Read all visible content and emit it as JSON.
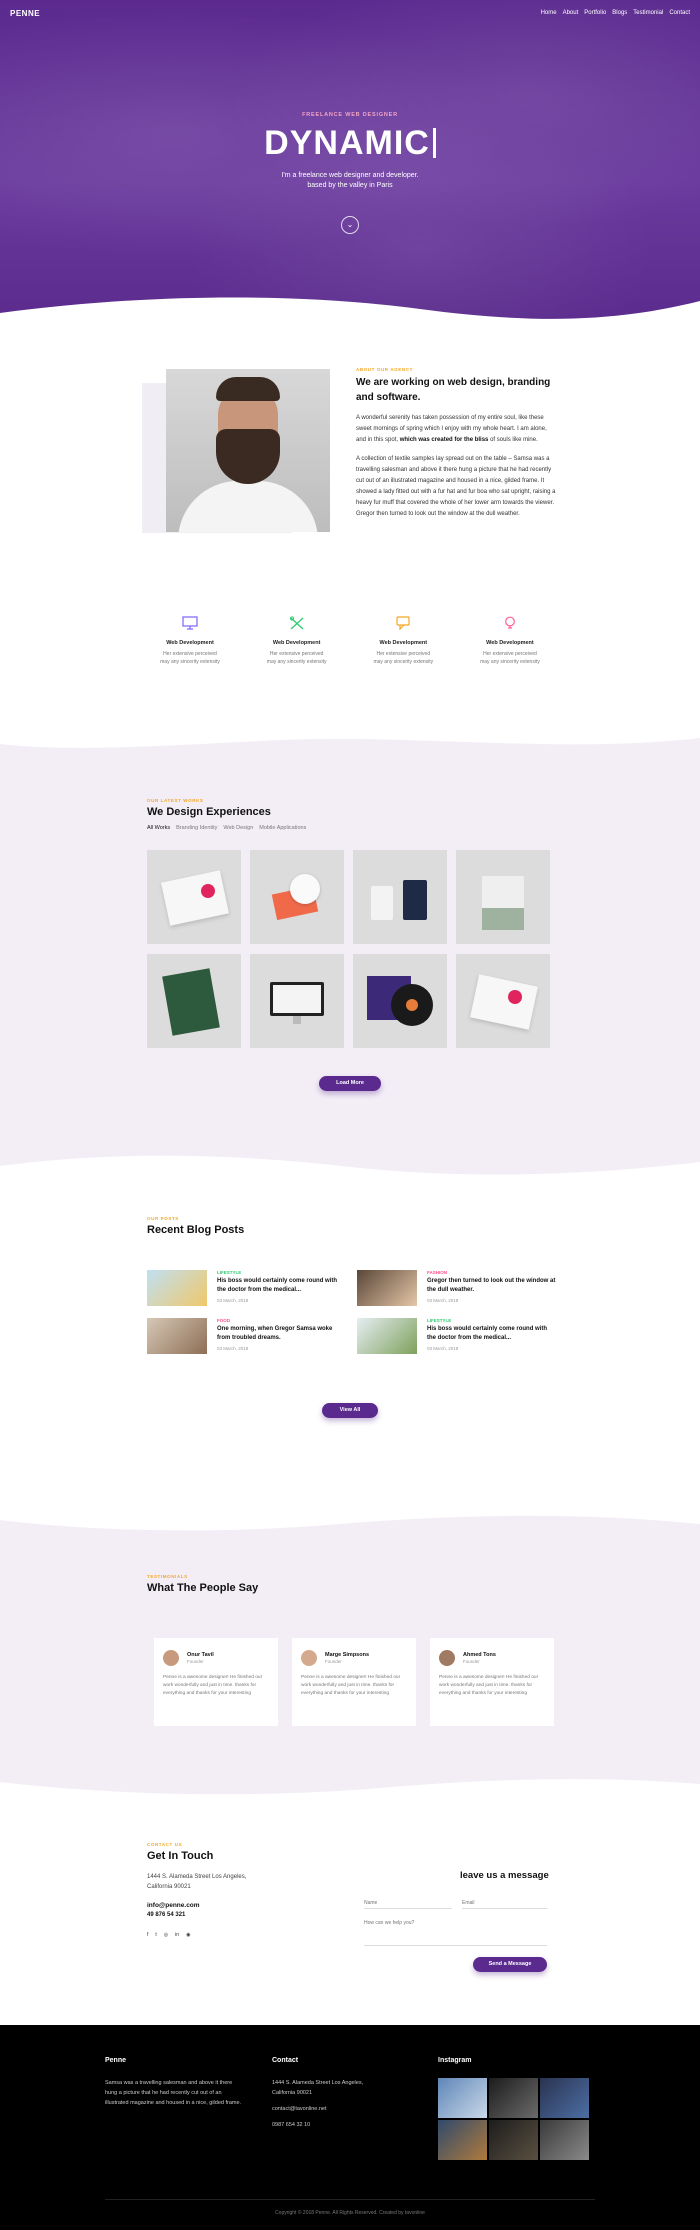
{
  "nav": {
    "logo": "PENNE",
    "items": [
      "Home",
      "About",
      "Portfolio",
      "Blogs",
      "Testimonial",
      "Contact"
    ]
  },
  "hero": {
    "kicker": "FREELANCE WEB DESIGNER",
    "title": "DYNAMIC",
    "subtitle_line1": "I'm a freelance web designer and developer.",
    "subtitle_line2": "based by the valley in Paris",
    "scroll_icon": "chevron-down-icon"
  },
  "about": {
    "kicker": "ABOUT OUR AGENCY",
    "title": "We are working on web design, branding and software.",
    "p1_start": "A wonderful serenity has taken possession of my entire soul, like these sweet mornings of spring which I enjoy with my whole heart. I am alone, and in this spot, ",
    "p1_bold": "which was created for the bliss",
    "p1_end": " of souls like mine.",
    "p2": "A collection of textile samples lay spread out on the table – Samsa was a travelling salesman and above it there hung a picture that he had recently cut out of an illustrated magazine and housed in a nice, gilded frame. It showed a lady fitted out with a fur hat and fur boa who sat upright, raising a heavy fur muff that covered the whole of her lower arm towards the viewer. Gregor then turned to look out the window at the dull weather."
  },
  "services": [
    {
      "icon": "monitor-icon",
      "title": "Web Development",
      "desc1": "Her extensive perceived",
      "desc2": "may any sincerity extensity",
      "color": "#7b61ff"
    },
    {
      "icon": "tools-icon",
      "title": "Web Development",
      "desc1": "Her extensive perceived",
      "desc2": "may any sincerity extensity",
      "color": "#2ecc71"
    },
    {
      "icon": "chat-icon",
      "title": "Web Development",
      "desc1": "Her extensive perceived",
      "desc2": "may any sincerity extensity",
      "color": "#f5a623"
    },
    {
      "icon": "bulb-icon",
      "title": "Web Development",
      "desc1": "Her extensive perceived",
      "desc2": "may any sincerity extensity",
      "color": "#ff5f8f"
    }
  ],
  "portfolio": {
    "kicker": "OUR LATEST WORKS",
    "title": "We Design Experiences",
    "filters": [
      "All Works",
      "Branding Identity",
      "Web Design",
      "Mobile Applications"
    ],
    "load_more": "Load More"
  },
  "blog": {
    "kicker": "OUR POSTS",
    "title": "Recent Blog Posts",
    "posts": [
      {
        "category": "LIFESTYLE",
        "cat_color": "#2ecc71",
        "title": "His boss would certainly come round with the doctor from the medical...",
        "date": "03 March, 2018"
      },
      {
        "category": "FASHION",
        "cat_color": "#ff4f8b",
        "title": "Gregor then turned to look out the window at the dull weather.",
        "date": "03 March, 2018"
      },
      {
        "category": "FOOD",
        "cat_color": "#ff4f8b",
        "title": "One morning, when Gregor Samsa woke from troubled dreams.",
        "date": "03 March, 2018"
      },
      {
        "category": "LIFESTYLE",
        "cat_color": "#2ecc71",
        "title": "His boss would certainly come round with the doctor from the medical...",
        "date": "03 March, 2018"
      }
    ],
    "view_all": "View All"
  },
  "testimonials": {
    "kicker": "TESTIMONIALS",
    "title": "What The People Say",
    "cards": [
      {
        "name": "Onur Tavil",
        "role": "Founder",
        "text": "Penne is a awesome designer! He finished our work wonderfully and just in time. thanks for everything and thanks for your interesting"
      },
      {
        "name": "Marge Simpsons",
        "role": "Founder",
        "text": "Penne is a awesome designer! He finished our work wonderfully and just in time. thanks for everything and thanks for your interesting"
      },
      {
        "name": "Ahmed Tons",
        "role": "Founder",
        "text": "Penne is a awesome designer! He finished our work wonderfully and just in time. thanks for everything and thanks for your interesting"
      }
    ]
  },
  "contact": {
    "kicker": "CONTACT US",
    "title": "Get In Touch",
    "address_line1": "1444 S. Alameda Street Los Angeles,",
    "address_line2": "California 90021",
    "email": "info@penne.com",
    "phone": "49 876 54 321",
    "socials": [
      "f",
      "t",
      "◎",
      "in",
      "◉"
    ],
    "form_title": "leave us a message",
    "name_placeholder": "Name",
    "email_placeholder": "Email",
    "message_placeholder": "How can we help you?",
    "send": "Send a Message"
  },
  "footer": {
    "brand": "Penne",
    "about_text": "Samsa was a travelling salesman and above it there hung a picture that he had recently cut out of an illustrated magazine and housed in a nice, gilded frame.",
    "contact_title": "Contact",
    "address_line1": "1444 S. Alameda Street Los Angeles,",
    "address_line2": "California 90021",
    "email": "contact@tavonline.net",
    "phone": "0987 654 32 10",
    "instagram_title": "Instagram",
    "copyright": "Copyright © 2018 Penne. All Rights Reserved. Created by tavonline"
  }
}
